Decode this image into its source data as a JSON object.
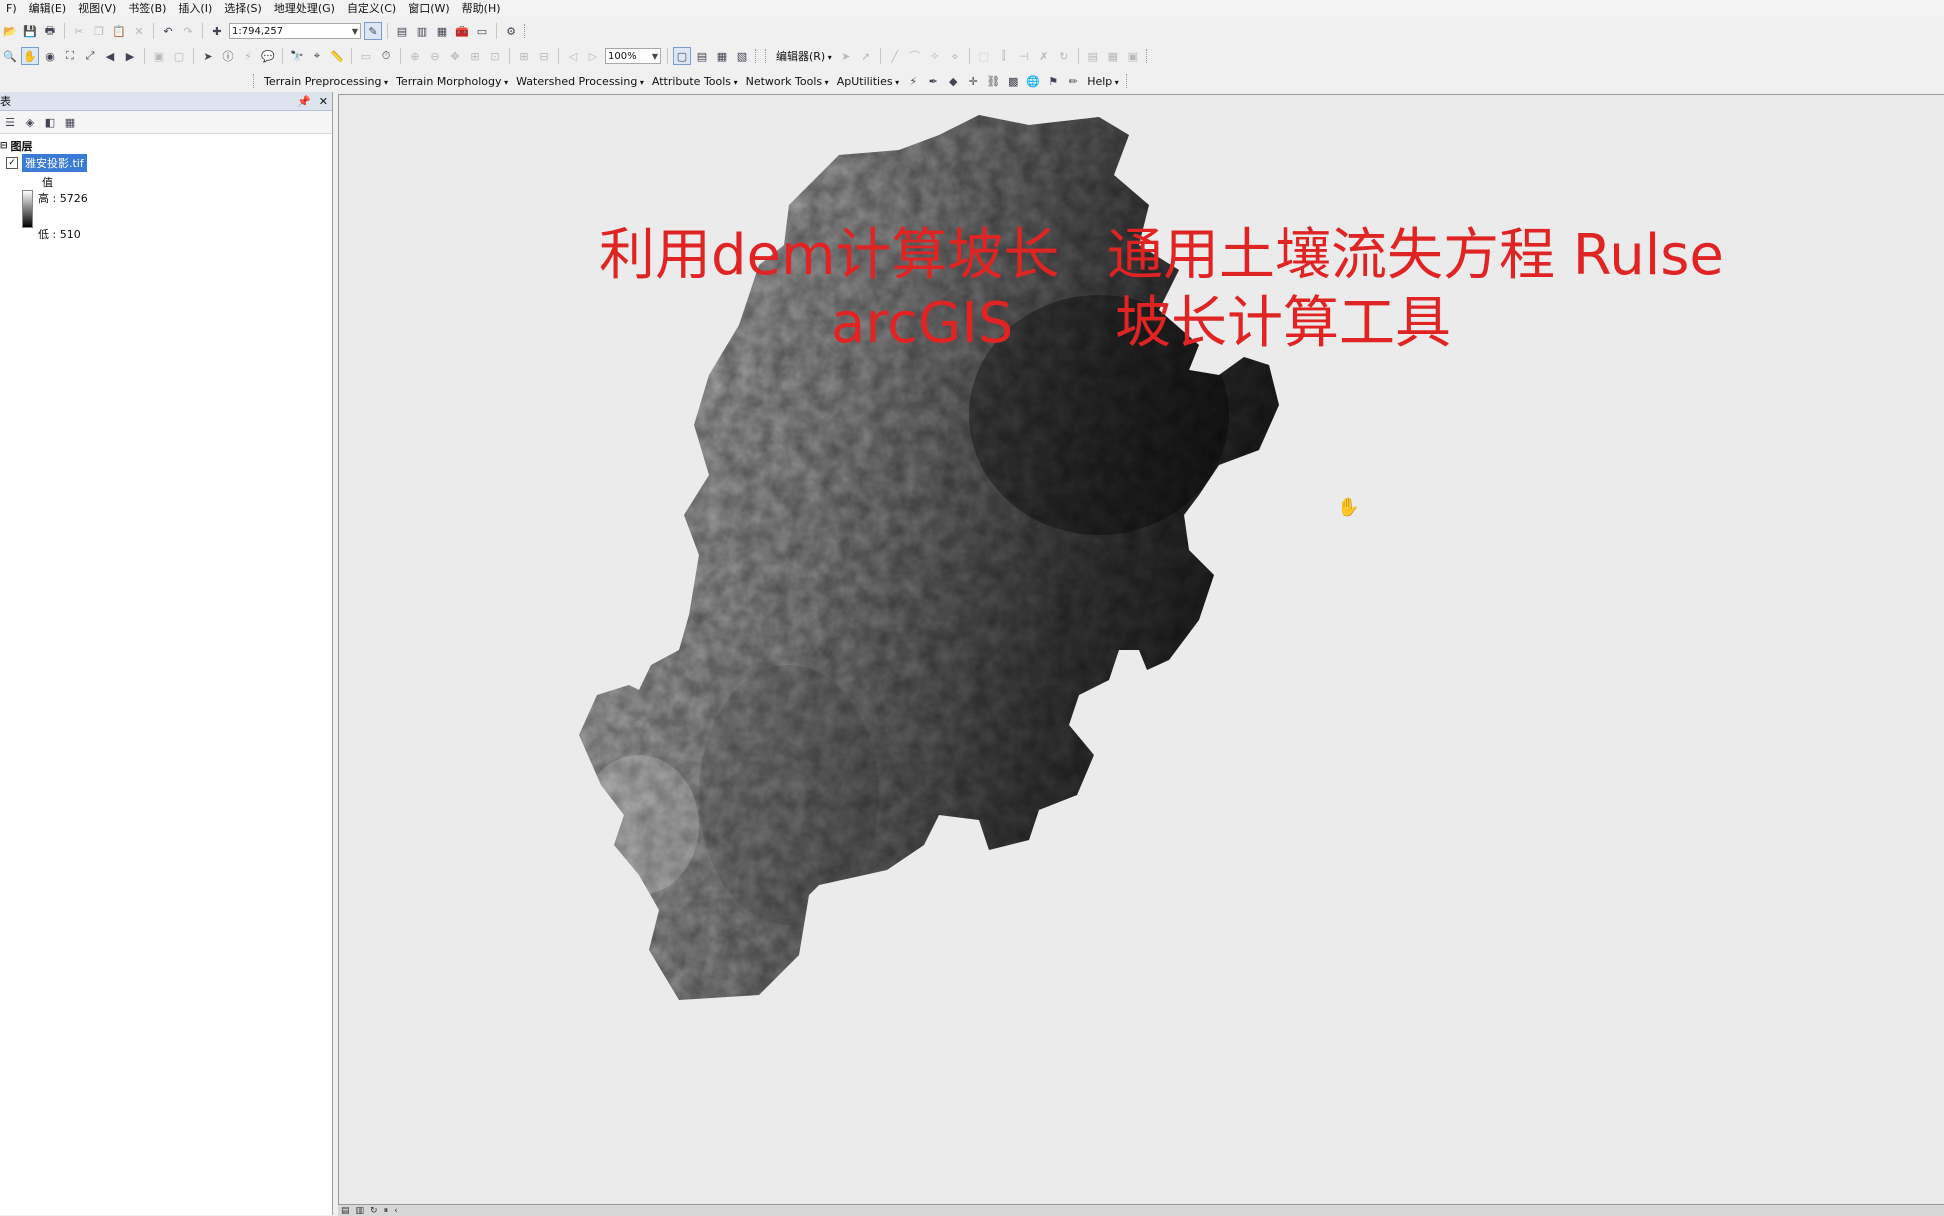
{
  "menu": [
    "F)",
    "编辑(E)",
    "视图(V)",
    "书签(B)",
    "插入(I)",
    "选择(S)",
    "地理处理(G)",
    "自定义(C)",
    "窗口(W)",
    "帮助(H)"
  ],
  "toolbar1": {
    "scale": "1:794,257"
  },
  "toolbar2": {
    "zoom": "100%",
    "editor_label": "编辑器(R)"
  },
  "toolbar3": {
    "menus": [
      "Terrain Preprocessing",
      "Terrain Morphology",
      "Watershed Processing",
      "Attribute Tools",
      "Network Tools",
      "ApUtilities"
    ],
    "help": "Help"
  },
  "toc": {
    "title": "表",
    "layers_label": "图层",
    "layer_name": "雅安投影.tif",
    "legend_header": "值",
    "high_label": "高 : 5726",
    "low_label": "低 : 510"
  },
  "overlay": {
    "line1": "利用dem计算坡长",
    "line2": "arcGIS",
    "line3": "通用土壤流失方程 Rulse",
    "line4": "坡长计算工具"
  },
  "icons": [
    "open-icon",
    "save-icon",
    "print-icon",
    "cut-icon",
    "copy-icon",
    "paste-icon",
    "delete-icon",
    "undo-icon",
    "redo-icon",
    "add-data-icon",
    "pan-icon",
    "zoom-icon",
    "identify-icon",
    "select-icon",
    "hand-cursor-icon"
  ]
}
